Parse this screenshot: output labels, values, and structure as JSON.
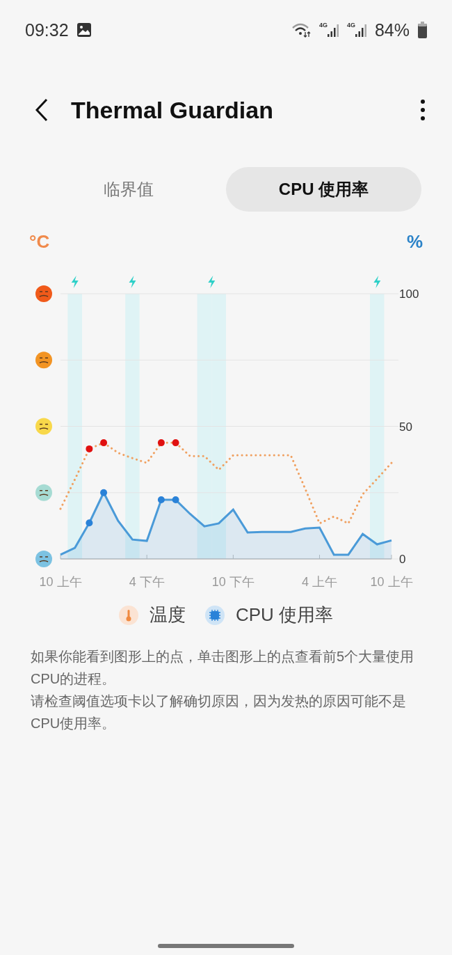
{
  "status_bar": {
    "time": "09:32",
    "networks": [
      "4G",
      "4G"
    ],
    "battery": "84%"
  },
  "header": {
    "title": "Thermal Guardian"
  },
  "tabs": [
    {
      "label": "临界值",
      "selected": false
    },
    {
      "label": "CPU 使用率",
      "selected": true
    }
  ],
  "chart": {
    "left_unit": "°C",
    "right_unit": "%",
    "charging": [
      false,
      true,
      false,
      false,
      false,
      true,
      false,
      false,
      false,
      false,
      true,
      true,
      false,
      false,
      false,
      false,
      false,
      false,
      false,
      false,
      false,
      false,
      true,
      false
    ],
    "highlighted": [
      false,
      false,
      true,
      true,
      false,
      false,
      false,
      true,
      true,
      false,
      false,
      false,
      false,
      false,
      false,
      false,
      false,
      false,
      false,
      false,
      false,
      false,
      false,
      false
    ],
    "chart_data": {
      "type": "line",
      "categories": [
        "10 上午",
        null,
        null,
        null,
        null,
        null,
        "4 下午",
        null,
        null,
        null,
        null,
        null,
        "10 下午",
        null,
        null,
        null,
        null,
        null,
        "4 上午",
        null,
        null,
        null,
        null,
        "10 上午"
      ],
      "series": [
        {
          "name": "温度",
          "line_style": "dotted",
          "color": "#f0a060",
          "values": [
            18.9,
            30,
            41.5,
            43.8,
            40,
            38,
            36.2,
            43.8,
            43.8,
            38.8,
            38.8,
            33.6,
            39.1,
            39.1,
            39.1,
            39.1,
            39.1,
            26.5,
            13.4,
            16,
            13.4,
            24.4,
            30.2,
            36.2
          ]
        },
        {
          "name": "CPU 使用率",
          "line_style": "solid",
          "color": "#4a9ad8",
          "values": [
            1.6,
            4.2,
            13.6,
            25,
            14.4,
            7.3,
            6.8,
            22.3,
            22.3,
            17,
            12.3,
            13.4,
            18.6,
            10,
            10.2,
            10.2,
            10.2,
            11.5,
            11.8,
            1.6,
            1.6,
            9.4,
            5.5,
            7
          ]
        }
      ],
      "ylim": [
        0,
        100
      ],
      "yticks": [
        0,
        50,
        100
      ]
    }
  },
  "notes": [
    "如果你能看到图形上的点，单击图形上的点查看前5个大量使用CPU的进程。",
    "请检查阈值选项卡以了解确切原因，因为发热的原因可能不是CPU使用率。"
  ]
}
